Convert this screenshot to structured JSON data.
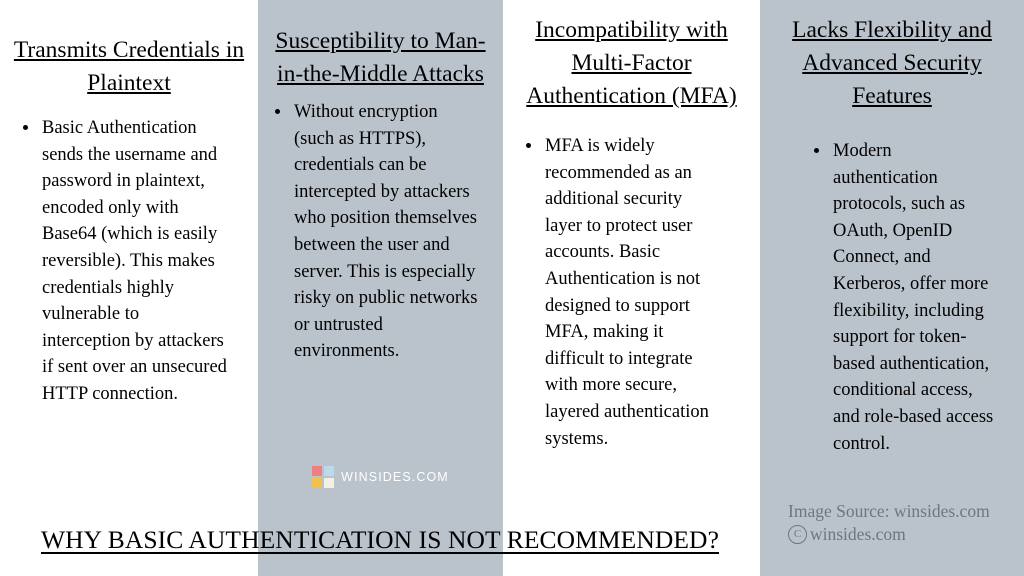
{
  "columns": [
    {
      "title": "Transmits Credentials in Plaintext",
      "bullets": [
        "Basic Authentication sends the username and password in plaintext, encoded only with Base64 (which is easily reversible). This makes credentials highly vulnerable to interception by attackers if sent over an unsecured HTTP connection."
      ],
      "background": "#ffffff"
    },
    {
      "title": "Susceptibility to Man-in-the-Middle Attacks",
      "bullets": [
        "Without encryption (such as HTTPS), credentials can be intercepted by attackers who position themselves between the user and server. This is especially risky on public networks or untrusted environments."
      ],
      "background": "#bac2cc"
    },
    {
      "title": "Incompatibility with Multi-Factor Authentication (MFA)",
      "bullets": [
        "MFA is widely recommended as an additional security layer to protect user accounts. Basic Authentication is not designed to support MFA, making it difficult to integrate with more secure, layered authentication systems."
      ],
      "background": "#ffffff"
    },
    {
      "title": "Lacks Flexibility and Advanced Security Features",
      "bullets": [
        "Modern authentication protocols, such as OAuth, OpenID Connect, and Kerberos, offer more flexibility, including support for token-based authentication, conditional access, and role-based access control."
      ],
      "background": "#bac2cc"
    }
  ],
  "watermark": {
    "text": "WINSIDES.COM",
    "logo_icon": "winsides-logo-icon",
    "logo_colors": {
      "top_left": "#f08080",
      "top_right": "#bcd9ee",
      "bottom_left": "#f2c14b",
      "bottom_right": "#f3f0e6"
    },
    "text_color": "#ffffff"
  },
  "attribution": {
    "source_line": "Image Source: winsides.com",
    "copyright_symbol": "C",
    "copyright_text": "winsides.com",
    "color": "#6e7680"
  },
  "banner": {
    "headline": "WHY BASIC AUTHENTICATION IS NOT RECOMMENDED?"
  }
}
